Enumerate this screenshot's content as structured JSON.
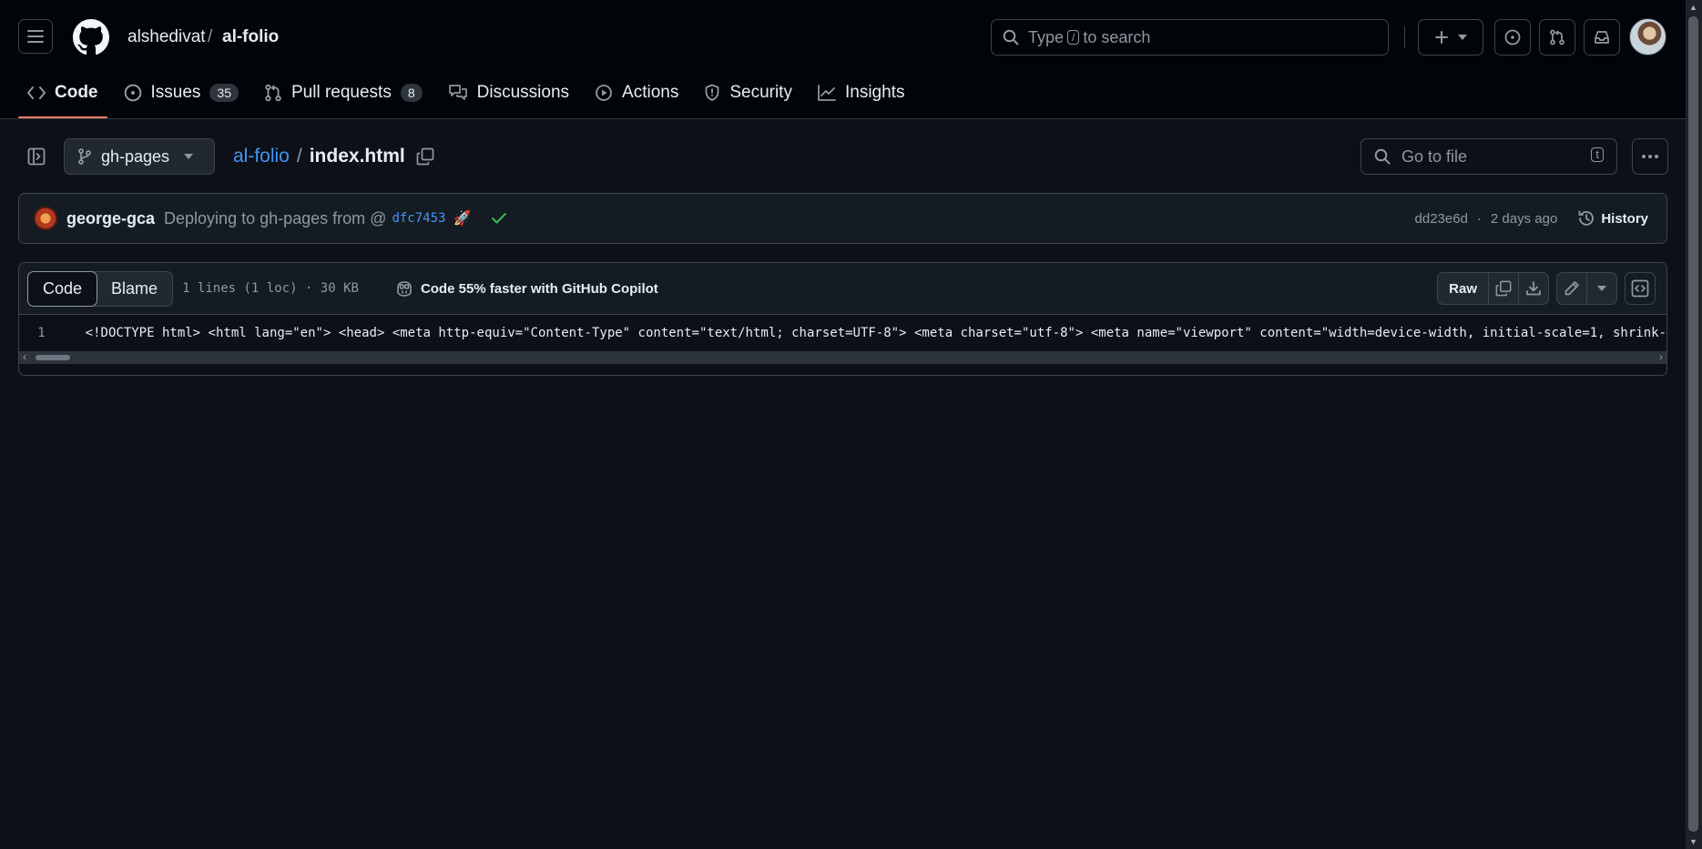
{
  "header": {
    "owner": "alshedivat",
    "separator": "/",
    "repo": "al-folio",
    "search": {
      "before": "Type",
      "key": "/",
      "after": "to search"
    }
  },
  "nav": {
    "tabs": [
      {
        "label": "Code",
        "icon": "code-icon",
        "active": true
      },
      {
        "label": "Issues",
        "icon": "issue-opened-icon",
        "count": "35"
      },
      {
        "label": "Pull requests",
        "icon": "git-pull-request-icon",
        "count": "8"
      },
      {
        "label": "Discussions",
        "icon": "comment-discussion-icon"
      },
      {
        "label": "Actions",
        "icon": "play-icon"
      },
      {
        "label": "Security",
        "icon": "shield-icon"
      },
      {
        "label": "Insights",
        "icon": "graph-icon"
      }
    ]
  },
  "file_header": {
    "branch": "gh-pages",
    "repo_link": "al-folio",
    "separator": "/",
    "filename": "index.html",
    "goto_placeholder": "Go to file",
    "goto_key": "t"
  },
  "commit": {
    "author": "george-gca",
    "message": "Deploying to gh-pages from @",
    "sha_link": "dfc7453",
    "emoji": "🚀",
    "short_sha": "dd23e6d",
    "dot": "·",
    "time": "2 days ago",
    "history_label": "History"
  },
  "code_view": {
    "tab_code": "Code",
    "tab_blame": "Blame",
    "meta": "1 lines (1 loc) · 30 KB",
    "copilot": "Code 55% faster with GitHub Copilot",
    "raw_label": "Raw",
    "line_number": "1",
    "line_text": "<!DOCTYPE html> <html lang=\"en\"> <head> <meta http-equiv=\"Content-Type\" content=\"text/html; charset=UTF-8\"> <meta charset=\"utf-8\"> <meta name=\"viewport\" content=\"width=device-width, initial-scale=1, shrink-"
  },
  "colors": {
    "background": "#0d1117",
    "header_bg": "#010409",
    "accent_underline": "#f78166",
    "link": "#4493f8",
    "success": "#3fb950"
  }
}
